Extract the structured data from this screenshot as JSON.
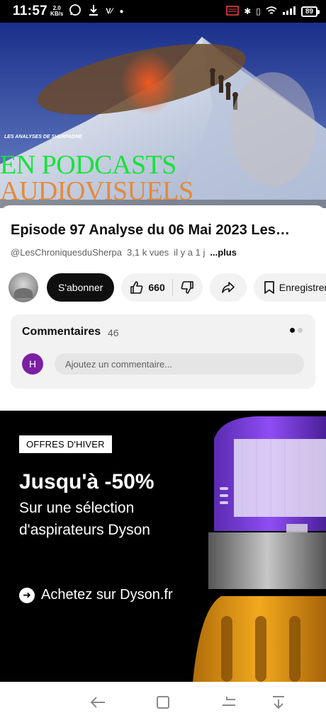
{
  "status_bar": {
    "time": "11:57",
    "net_speed_value": "2.0",
    "net_speed_unit": "KB/s",
    "battery": "89"
  },
  "video": {
    "channel_brand": "LES ANALYSES DE SHERPADNE",
    "overlay_line1": "EN PODCASTS",
    "overlay_line2": "AUDIOVISUELS"
  },
  "details": {
    "title": "Episode 97 Analyse du 06 Mai 2023 Les…",
    "channel": "@LesChroniquesduSherpa",
    "views": "3,1 k vues",
    "age": "il y a 1 j",
    "more": "...plus"
  },
  "actions": {
    "subscribe": "S'abonner",
    "likes": "660",
    "save": "Enregistrer"
  },
  "comments": {
    "title": "Commentaires",
    "count": "46",
    "user_initial": "H",
    "placeholder": "Ajoutez un commentaire..."
  },
  "ad": {
    "badge": "OFFRES D'HIVER",
    "headline": "Jusqu'à -50%",
    "sub_line1": "Sur une sélection",
    "sub_line2": "d'aspirateurs Dyson",
    "cta": "Achetez sur Dyson.fr"
  },
  "colors": {
    "overlay_green": "#18e23a",
    "overlay_orange": "#e58a3a",
    "subscribe_bg": "#0f0f0f",
    "comment_avatar": "#7b1fa2",
    "dyson_purple": "#8a3df0",
    "dyson_yellow": "#f2a91e"
  }
}
